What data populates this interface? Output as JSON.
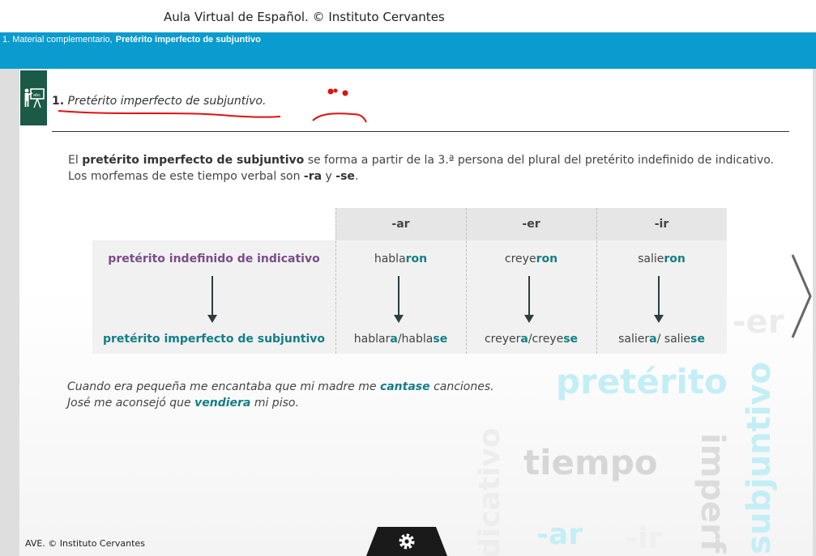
{
  "app_title": "Aula Virtual de Español. © Instituto Cervantes",
  "breadcrumb": {
    "section": "1. Material complementario,",
    "current": "Pretérito imperfecto de subjuntivo"
  },
  "lesson": {
    "number": "1.",
    "title": "Pretérito imperfecto de subjuntivo."
  },
  "intro": {
    "p1_a": "El ",
    "p1_b": "pretérito imperfecto de subjuntivo",
    "p1_c": " se forma a partir de la 3.ª persona del plural del pretérito indefinido de indicativo.",
    "p2_a": "Los morfemas de este tiempo verbal son ",
    "p2_b": "-ra",
    "p2_c": " y ",
    "p2_d": "-se",
    "p2_e": "."
  },
  "table": {
    "headers": [
      "-ar",
      "-er",
      "-ir"
    ],
    "row1_label": "pretérito indefinido de indicativo",
    "row2_label": "pretérito imperfecto de subjuntivo",
    "indefinido": [
      {
        "stem": "habla",
        "ending": "ron"
      },
      {
        "stem": "creye",
        "ending": "ron"
      },
      {
        "stem": "salie",
        "ending": "ron"
      }
    ],
    "subjuntivo": [
      {
        "s1": "hablar",
        "e1": "a",
        "sep": "/habla",
        "e2": "se"
      },
      {
        "s1": "creyer",
        "e1": "a",
        "sep": "/creye",
        "e2": "se"
      },
      {
        "s1": "salier",
        "e1": "a",
        "sep": "/ salie",
        "e2": "se"
      }
    ]
  },
  "examples": [
    {
      "a": "Cuando era pequeña me encantaba que mi madre me ",
      "b": "cantase",
      "c": " canciones."
    },
    {
      "a": "José me aconsejó que ",
      "b": "vendiera",
      "c": " mi piso."
    }
  ],
  "watermarks": {
    "pret": "pretérito",
    "tiempo": "tiempo",
    "er": "-er",
    "ar": "-ar",
    "ir": "-ir",
    "subj": "subjuntivo",
    "imperf": "imperf",
    "indic": "dicativo"
  },
  "footer": "AVE. © Instituto Cervantes",
  "colors": {
    "brand_blue": "#0a9bcf",
    "icon_green": "#1a5a46",
    "purple_label": "#7a4d86",
    "teal_label": "#147e86",
    "annotation_red": "#e01010"
  },
  "icons": {
    "lesson": "teacher-board-icon",
    "next": "chevron-right-icon",
    "settings": "gear-icon"
  }
}
